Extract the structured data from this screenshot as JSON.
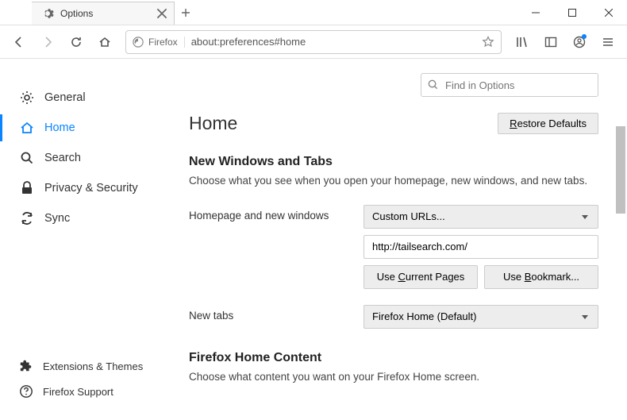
{
  "window": {
    "tab_title": "Options"
  },
  "urlbar": {
    "identity_label": "Firefox",
    "url": "about:preferences#home"
  },
  "search": {
    "placeholder": "Find in Options"
  },
  "sidebar": {
    "items": [
      {
        "label": "General"
      },
      {
        "label": "Home"
      },
      {
        "label": "Search"
      },
      {
        "label": "Privacy & Security"
      },
      {
        "label": "Sync"
      }
    ],
    "bottom": [
      {
        "label": "Extensions & Themes"
      },
      {
        "label": "Firefox Support"
      }
    ]
  },
  "main": {
    "heading": "Home",
    "restore_btn": "Restore Defaults",
    "section1_title": "New Windows and Tabs",
    "section1_desc": "Choose what you see when you open your homepage, new windows, and new tabs.",
    "row1_label": "Homepage and new windows",
    "row1_select": "Custom URLs...",
    "row1_input_value": "http://tailsearch.com/",
    "btn_current": "Use Current Pages",
    "btn_bookmark": "Use Bookmark...",
    "row2_label": "New tabs",
    "row2_select": "Firefox Home (Default)",
    "section2_title": "Firefox Home Content",
    "section2_desc": "Choose what content you want on your Firefox Home screen."
  }
}
